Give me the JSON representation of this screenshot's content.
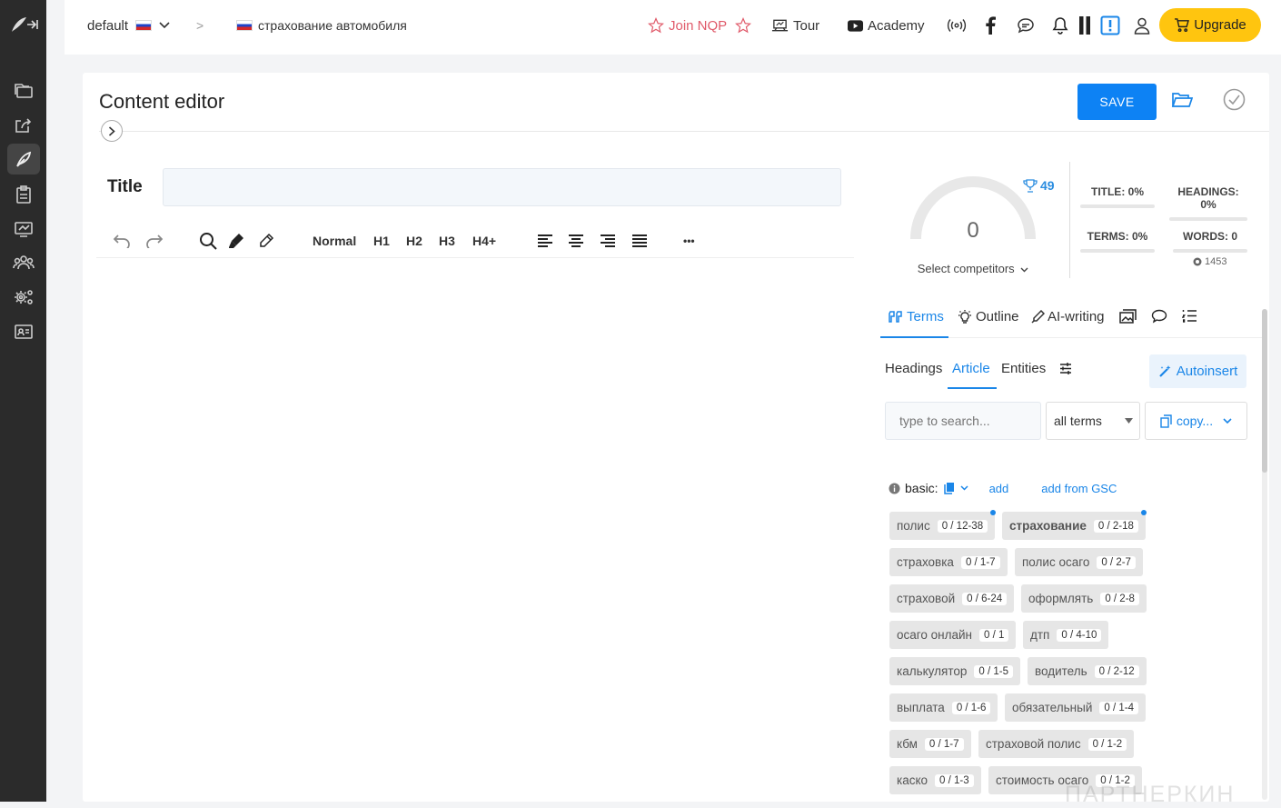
{
  "topbar": {
    "project": "default",
    "separator": ">",
    "document": "страхование автомобиля",
    "join": "Join NQP",
    "tour": "Tour",
    "academy": "Academy",
    "upgrade": "Upgrade"
  },
  "editor": {
    "heading": "Content editor",
    "save": "SAVE",
    "title_label": "Title",
    "title_value": "",
    "toolbar": {
      "normal": "Normal",
      "h1": "H1",
      "h2": "H2",
      "h3": "H3",
      "h4": "H4+",
      "more": "•••"
    }
  },
  "score": {
    "value": "0",
    "trophy": "49",
    "select_competitors": "Select competitors",
    "stats": {
      "title": "TITLE: 0%",
      "headings": "HEADINGS: 0%",
      "terms": "TERMS: 0%",
      "words": "WORDS: 0"
    },
    "words_sub": "1453"
  },
  "tabs": {
    "terms": "Terms",
    "outline": "Outline",
    "ai_writing": "AI-writing"
  },
  "subtabs": {
    "headings": "Headings",
    "article": "Article",
    "entities": "Entities",
    "autoinsert": "Autoinsert"
  },
  "filters": {
    "search_placeholder": "type to search...",
    "scope": "all terms",
    "copy": "copy..."
  },
  "basic": {
    "label": "basic:",
    "add": "add",
    "add_gsc": "add from GSC"
  },
  "terms": [
    {
      "term": "полис",
      "count": "0 / 12-38",
      "dot": true,
      "bold": false
    },
    {
      "term": "страхование",
      "count": "0 / 2-18",
      "dot": true,
      "bold": true
    },
    {
      "term": "страховка",
      "count": "0 / 1-7",
      "dot": false,
      "bold": false
    },
    {
      "term": "полис осаго",
      "count": "0 / 2-7",
      "dot": false,
      "bold": false
    },
    {
      "term": "страховой",
      "count": "0 / 6-24",
      "dot": false,
      "bold": false
    },
    {
      "term": "оформлять",
      "count": "0 / 2-8",
      "dot": false,
      "bold": false
    },
    {
      "term": "осаго онлайн",
      "count": "0 / 1",
      "dot": false,
      "bold": false
    },
    {
      "term": "дтп",
      "count": "0 / 4-10",
      "dot": false,
      "bold": false
    },
    {
      "term": "калькулятор",
      "count": "0 / 1-5",
      "dot": false,
      "bold": false
    },
    {
      "term": "водитель",
      "count": "0 / 2-12",
      "dot": false,
      "bold": false
    },
    {
      "term": "выплата",
      "count": "0 / 1-6",
      "dot": false,
      "bold": false
    },
    {
      "term": "обязательный",
      "count": "0 / 1-4",
      "dot": false,
      "bold": false
    },
    {
      "term": "кбм",
      "count": "0 / 1-7",
      "dot": false,
      "bold": false
    },
    {
      "term": "страховой полис",
      "count": "0 / 1-2",
      "dot": false,
      "bold": false
    },
    {
      "term": "каско",
      "count": "0 / 1-3",
      "dot": false,
      "bold": false
    },
    {
      "term": "стоимость осаго",
      "count": "0 / 1-2",
      "dot": false,
      "bold": false
    }
  ],
  "watermark": "ПАРТНЕРКИН",
  "colors": {
    "accent": "#1a86e8",
    "save": "#0d82f4",
    "upgrade": "#ffc50f",
    "sidebar": "#2b2b2b",
    "join": "#e05a6a"
  }
}
